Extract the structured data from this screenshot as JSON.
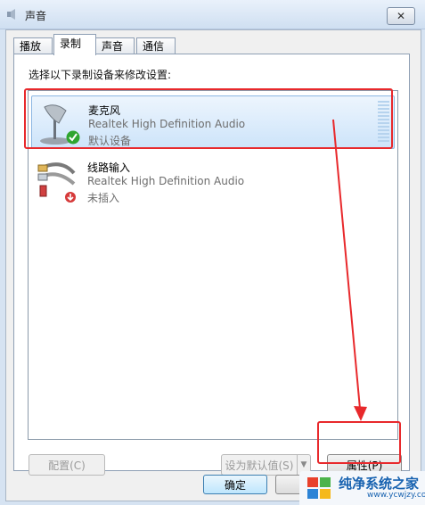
{
  "window": {
    "title": "声音",
    "close_glyph": "✕"
  },
  "tabs": [
    {
      "label": "播放",
      "active": false
    },
    {
      "label": "录制",
      "active": true
    },
    {
      "label": "声音",
      "active": false
    },
    {
      "label": "通信",
      "active": false
    }
  ],
  "panel": {
    "instruction": "选择以下录制设备来修改设置:"
  },
  "devices": [
    {
      "name": "麦克风",
      "driver": "Realtek High Definition Audio",
      "status": "默认设备",
      "icon": "microphone-icon",
      "badge": "default-check-icon",
      "selected": true
    },
    {
      "name": "线路输入",
      "driver": "Realtek High Definition Audio",
      "status": "未插入",
      "icon": "line-in-icon",
      "badge": "unplugged-icon",
      "selected": false
    }
  ],
  "buttons": {
    "configure": "配置(C)",
    "set_default": "设为默认值(S)",
    "properties": "属性(P)",
    "ok": "确定"
  },
  "watermark": {
    "title": "纯净系统之家",
    "url": "www.ycwjzy.com"
  },
  "colors": {
    "annotation_red": "#e8292c",
    "selection_blue": "#cde4fa",
    "check_green": "#2fa52f"
  }
}
